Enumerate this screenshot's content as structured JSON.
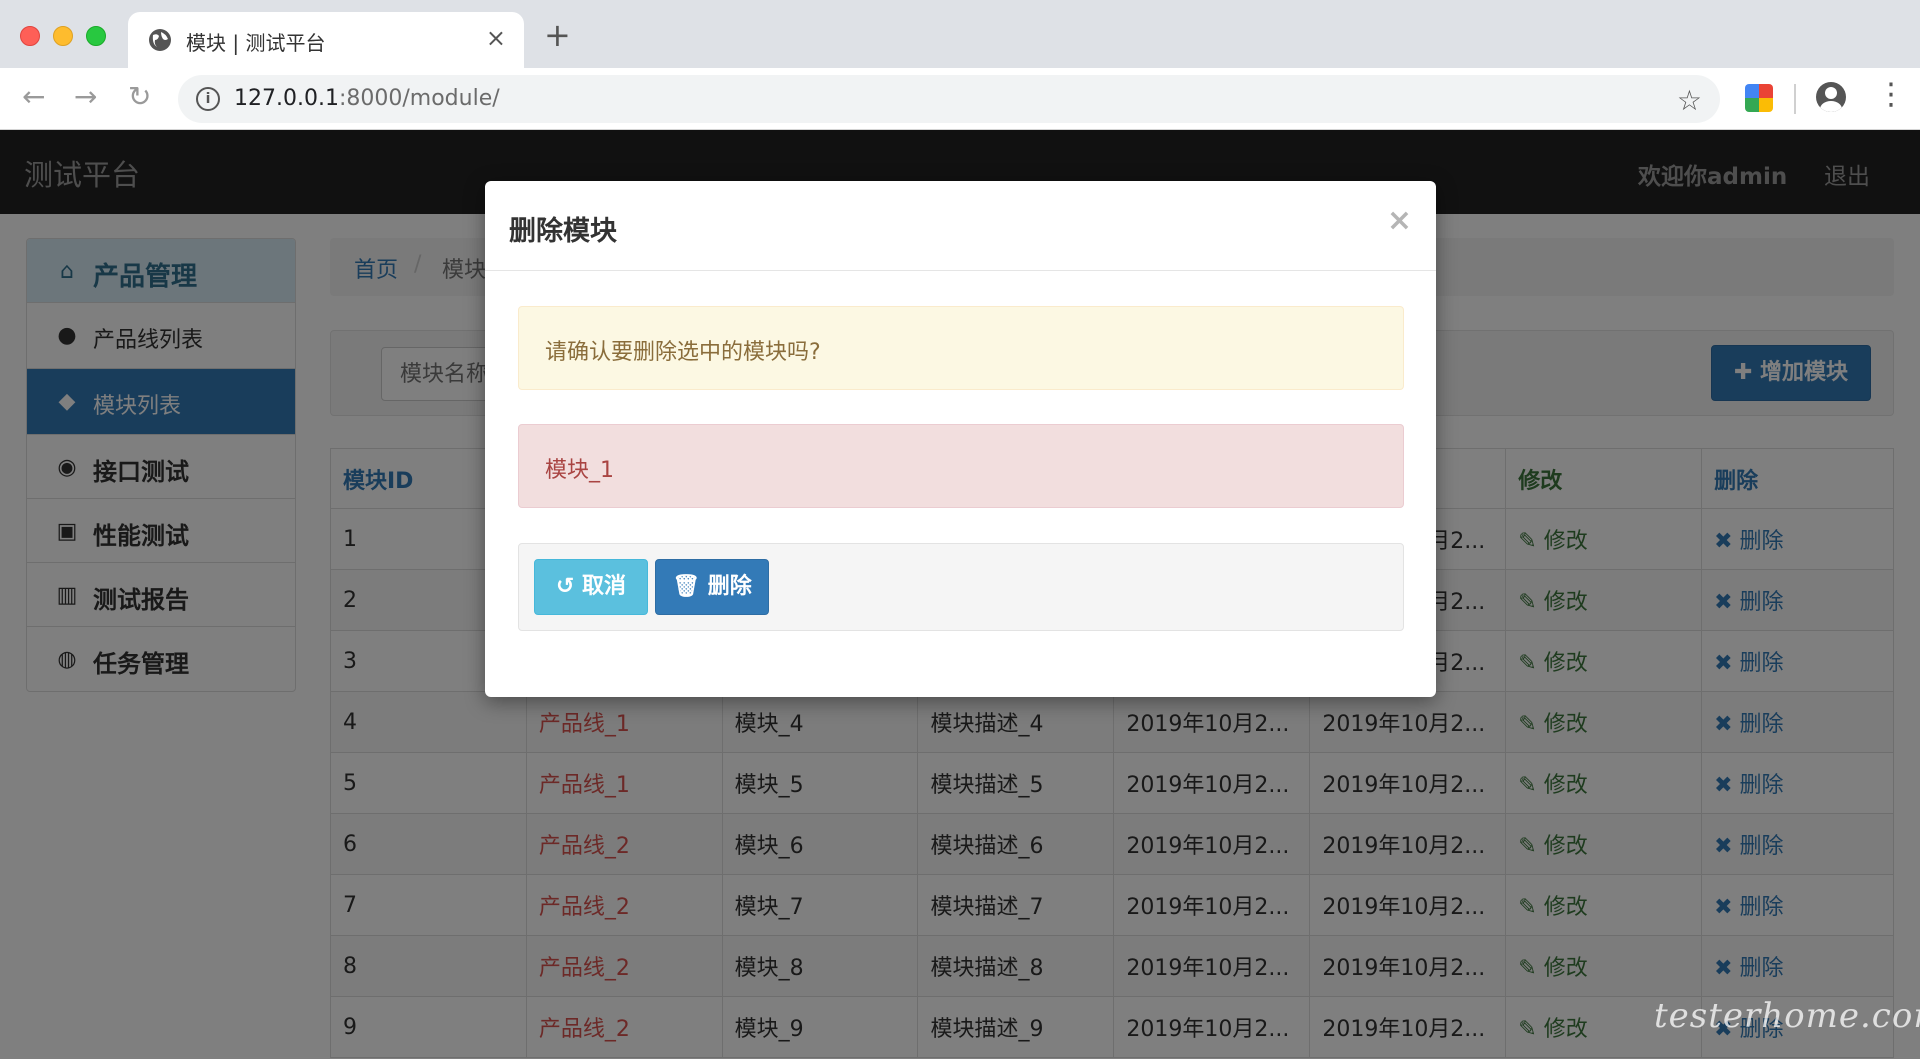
{
  "browser": {
    "tab_title": "模块 | 测试平台",
    "tab_close": "×",
    "new_tab": "+",
    "back": "←",
    "forward": "→",
    "reload": "↻",
    "url_host": "127.0.0.1",
    "url_rest": ":8000/module/",
    "info_icon": "i",
    "star": "☆",
    "menu": "⋮"
  },
  "navbar": {
    "brand": "测试平台",
    "welcome": "欢迎你admin",
    "logout": "退出"
  },
  "sidebar": {
    "header": {
      "icon": "⌂",
      "label": "产品管理"
    },
    "items": [
      {
        "icon": "●",
        "label": "产品线列表"
      },
      {
        "icon": "◆",
        "label": "模块列表"
      },
      {
        "icon": "◉",
        "label": "接口测试"
      },
      {
        "icon": "▣",
        "label": "性能测试"
      },
      {
        "icon": "▥",
        "label": "测试报告"
      },
      {
        "icon": "◍",
        "label": "任务管理"
      }
    ]
  },
  "breadcrumb": {
    "home": "首页",
    "sep": "/",
    "current": "模块"
  },
  "search": {
    "placeholder": "模块名称"
  },
  "add_button": "✚ 增加模块",
  "table": {
    "headers": [
      "模块ID",
      "",
      "",
      "",
      "",
      "",
      "修改",
      "删除"
    ],
    "rows": [
      [
        "1",
        "",
        "",
        "",
        "",
        "2019年10月2...",
        "✎ 修改",
        "✖ 删除"
      ],
      [
        "2",
        "",
        "",
        "",
        "",
        "2019年10月2...",
        "✎ 修改",
        "✖ 删除"
      ],
      [
        "3",
        "",
        "",
        "",
        "",
        "2019年10月2...",
        "✎ 修改",
        "✖ 删除"
      ],
      [
        "4",
        "产品线_1",
        "模块_4",
        "模块描述_4",
        "2019年10月2...",
        "2019年10月2...",
        "✎ 修改",
        "✖ 删除"
      ],
      [
        "5",
        "产品线_1",
        "模块_5",
        "模块描述_5",
        "2019年10月2...",
        "2019年10月2...",
        "✎ 修改",
        "✖ 删除"
      ],
      [
        "6",
        "产品线_2",
        "模块_6",
        "模块描述_6",
        "2019年10月2...",
        "2019年10月2...",
        "✎ 修改",
        "✖ 删除"
      ],
      [
        "7",
        "产品线_2",
        "模块_7",
        "模块描述_7",
        "2019年10月2...",
        "2019年10月2...",
        "✎ 修改",
        "✖ 删除"
      ],
      [
        "8",
        "产品线_2",
        "模块_8",
        "模块描述_8",
        "2019年10月2...",
        "2019年10月2...",
        "✎ 修改",
        "✖ 删除"
      ],
      [
        "9",
        "产品线_2",
        "模块_9",
        "模块描述_9",
        "2019年10月2...",
        "2019年10月2...",
        "✎ 修改",
        "✖ 删除"
      ]
    ]
  },
  "modal": {
    "title": "删除模块",
    "close": "×",
    "confirm_text": "请确认要删除选中的模块吗?",
    "target_name": "模块_1",
    "cancel_label": "↺ 取消",
    "delete_label": "🗑 删除"
  },
  "watermark": "testerhome.com"
}
